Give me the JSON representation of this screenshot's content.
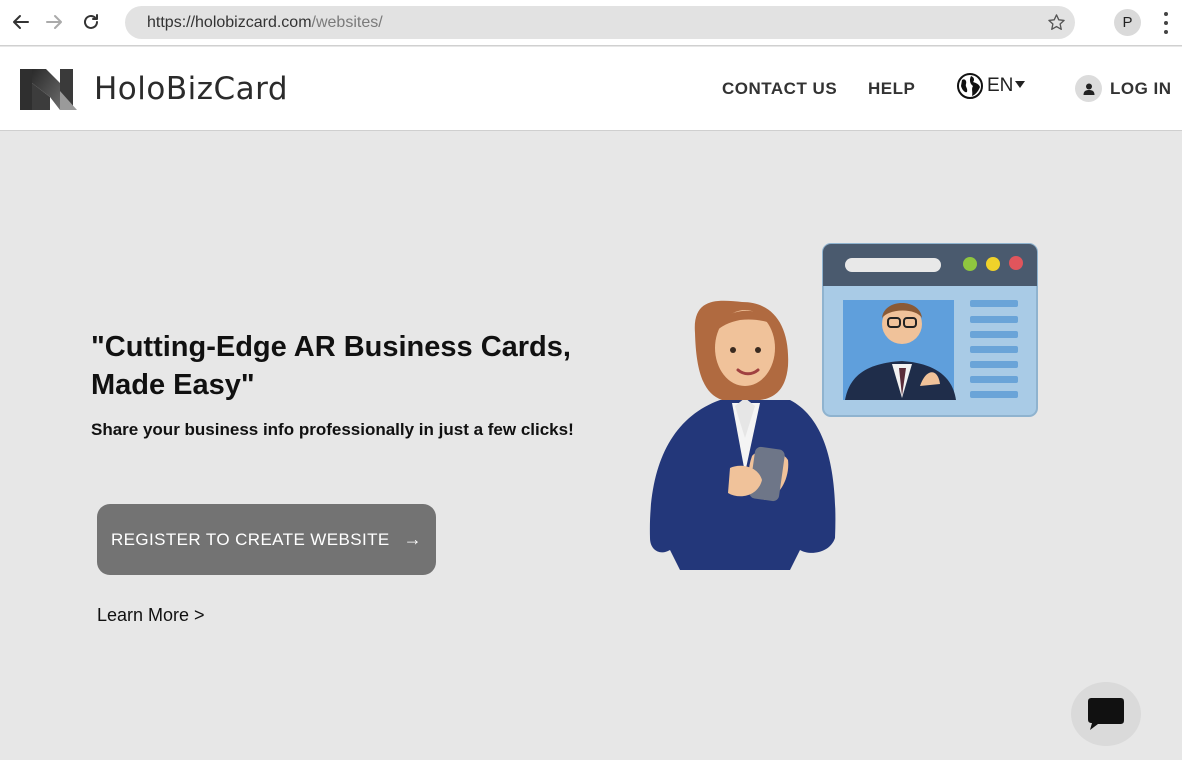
{
  "browser": {
    "url_host": "https://holobizcard.com",
    "url_path": "/websites/",
    "profile_initial": "P"
  },
  "header": {
    "brand": "HoloBizCard",
    "nav": {
      "contact": "CONTACT US",
      "help": "HELP",
      "language": "EN",
      "login": "LOG IN"
    }
  },
  "hero": {
    "headline": "\"Cutting-Edge AR Business Cards, Made Easy\"",
    "subheadline": "Share your business info professionally in just a few clicks!",
    "cta_label": "REGISTER TO CREATE WEBSITE",
    "cta_arrow": "→",
    "learn_more": "Learn More >"
  },
  "colors": {
    "page_bg": "#e7e7e7",
    "cta_bg": "#737373",
    "header_bg": "#ffffff"
  },
  "icons": [
    "back-arrow-icon",
    "forward-arrow-icon",
    "reload-icon",
    "star-icon",
    "kebab-menu-icon",
    "globe-icon",
    "user-icon",
    "chat-bubble-icon"
  ]
}
